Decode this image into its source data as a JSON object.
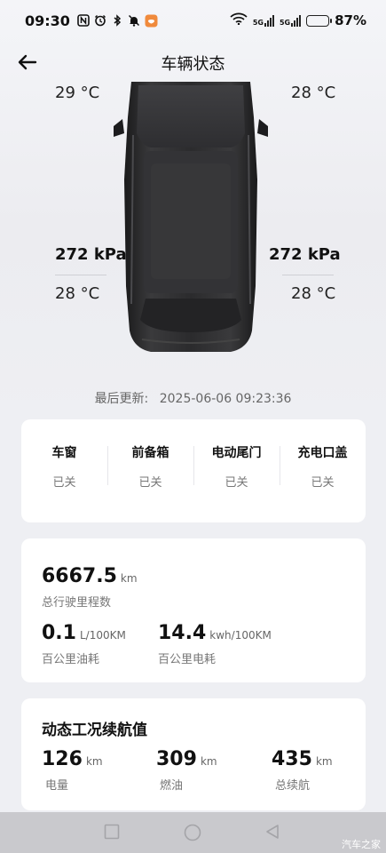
{
  "status_bar": {
    "time": "09:30",
    "net_label_1": "5G",
    "net_label_2": "5G",
    "battery_percent": "87%",
    "battery_level": 0.87,
    "icons": [
      "nfc-icon",
      "alarm-icon",
      "bluetooth-icon",
      "mute-icon",
      "app-notification-icon",
      "wifi-icon",
      "signal-icon",
      "battery-icon"
    ]
  },
  "header": {
    "title": "车辆状态",
    "back_icon": "arrow-left-icon"
  },
  "tires": {
    "front_left_temp": "29 °C",
    "front_right_temp": "28 °C",
    "rear_left_pressure": "272 kPa",
    "rear_right_pressure": "272 kPa",
    "rear_left_temp": "28 °C",
    "rear_right_temp": "28 °C"
  },
  "last_update": {
    "label": "最后更新:",
    "timestamp": "2025-06-06 09:23:36"
  },
  "vehicle_status": [
    {
      "title": "车窗",
      "value": "已关"
    },
    {
      "title": "前备箱",
      "value": "已关"
    },
    {
      "title": "电动尾门",
      "value": "已关"
    },
    {
      "title": "充电口盖",
      "value": "已关"
    }
  ],
  "mileage": {
    "total": {
      "value": "6667.5",
      "unit": "km",
      "label": "总行驶里程数"
    },
    "fuel": {
      "value": "0.1",
      "unit": "L/100KM",
      "label": "百公里油耗"
    },
    "power": {
      "value": "14.4",
      "unit": "kwh/100KM",
      "label": "百公里电耗"
    }
  },
  "range": {
    "title": "动态工况续航值",
    "items": [
      {
        "value": "126",
        "unit": "km",
        "label": "电量"
      },
      {
        "value": "309",
        "unit": "km",
        "label": "燃油"
      },
      {
        "value": "435",
        "unit": "km",
        "label": "总续航"
      }
    ]
  },
  "nav_bar": {
    "watermark": "汽车之家",
    "buttons": [
      "recent-apps-icon",
      "home-icon",
      "back-triangle-icon"
    ]
  },
  "colors": {
    "background": "#eeeff3",
    "card": "#ffffff",
    "car_body": "#2a2a2c"
  }
}
